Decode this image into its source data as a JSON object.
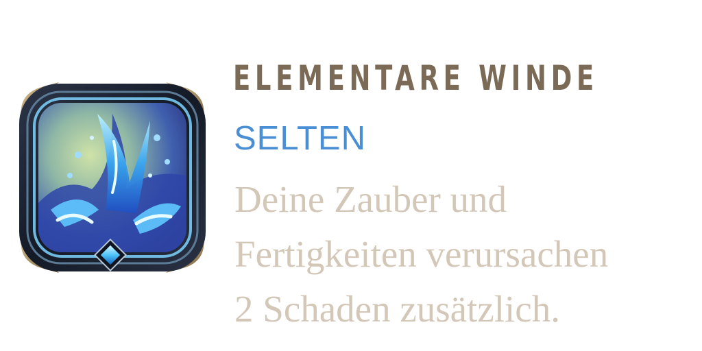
{
  "card": {
    "title": "ELEMENTARE WINDE",
    "rarity": "SELTEN",
    "description_lines": [
      "Deine Zauber und",
      "Fertigkeiten verursachen",
      "2 Schaden zusätzlich."
    ],
    "icon": "water-splash-icon"
  },
  "colors": {
    "title": "#7b6a55",
    "rarity": "#4a8fd4",
    "description": "#d3c8b8",
    "frame_dark": "#1b2230",
    "frame_gold": "#b59a6a",
    "gem": "#4fc3f7"
  }
}
